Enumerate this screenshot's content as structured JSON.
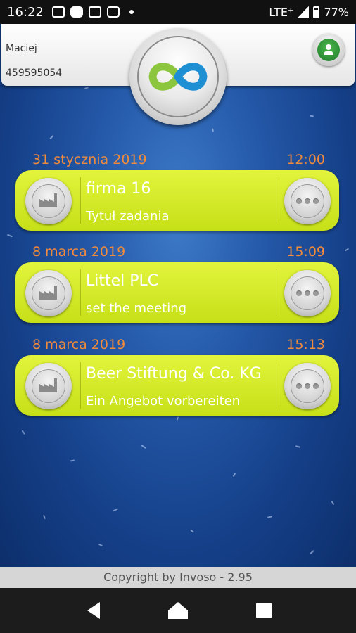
{
  "status_bar": {
    "time": "16:22",
    "network": "LTE⁺",
    "battery": "77%"
  },
  "user": {
    "name": "Maciej",
    "id": "459595054"
  },
  "tasks": [
    {
      "date": "31 stycznia 2019",
      "time": "12:00",
      "company": "firma 16",
      "title": "Tytuł zadania"
    },
    {
      "date": "8 marca 2019",
      "time": "15:09",
      "company": "Littel PLC",
      "title": "set the meeting"
    },
    {
      "date": "8 marca 2019",
      "time": "15:13",
      "company": "Beer Stiftung & Co. KG",
      "title": "Ein Angebot vorbereiten"
    }
  ],
  "footer": {
    "copyright": "Copyright by Invoso - 2.95"
  },
  "colors": {
    "accent": "#d4ea2a",
    "date_text": "#f08a3c",
    "background": "#1f4f9e"
  },
  "icons": [
    "image-icon",
    "youtube-icon",
    "mail-icon",
    "camera-icon",
    "signal-icon",
    "battery-icon",
    "infinity-logo-icon",
    "user-avatar-icon",
    "factory-icon",
    "more-dots-icon",
    "back-icon",
    "home-icon",
    "recents-icon"
  ]
}
